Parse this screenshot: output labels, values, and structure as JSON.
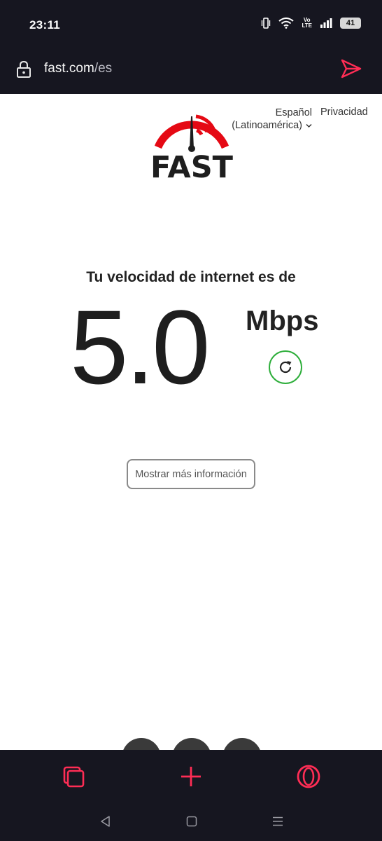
{
  "status_bar": {
    "time": "23:11",
    "network_label_top": "Vo",
    "network_label_bottom": "LTE",
    "battery": "41"
  },
  "address_bar": {
    "url_host": "fast.com",
    "url_path": "/es"
  },
  "page": {
    "logo_text": "FAST",
    "language": {
      "line1": "Español",
      "line2": "(Latinoamérica)"
    },
    "privacy_link": "Privacidad",
    "speed_caption": "Tu velocidad de internet es de",
    "speed_value": "5.0",
    "speed_unit": "Mbps",
    "more_info_button": "Mostrar más información"
  },
  "colors": {
    "brand_red": "#e50914",
    "accent_red": "#ff2d55",
    "success_green": "#2eae3b",
    "chrome_dark": "#161620"
  },
  "icons": {
    "lock": "lock-icon",
    "send": "send-icon",
    "refresh": "refresh-icon",
    "tabs": "tabs-icon",
    "new_tab": "plus-icon",
    "opera": "opera-icon"
  }
}
